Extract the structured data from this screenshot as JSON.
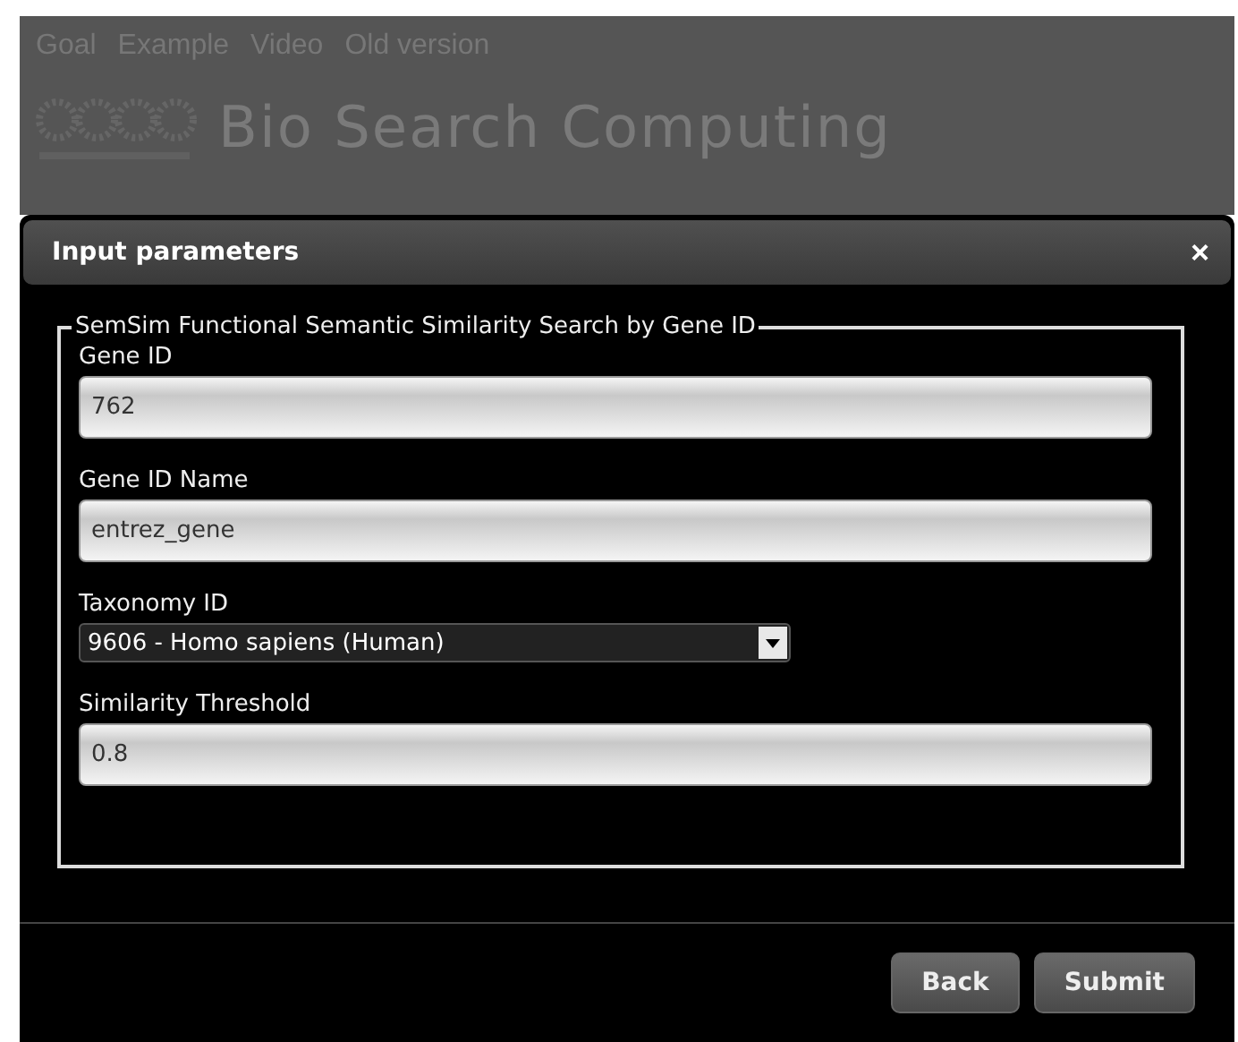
{
  "nav": [
    "Goal",
    "Example",
    "Video",
    "Old version"
  ],
  "site_title": "Bio Search Computing",
  "dialog": {
    "title": "Input parameters",
    "close": "×",
    "fieldset": {
      "legend": "SemSim Functional Semantic Similarity Search by Gene ID",
      "fields": [
        {
          "kind": "text",
          "label": "Gene ID",
          "value": "762"
        },
        {
          "kind": "text",
          "label": "Gene ID Name",
          "value": "entrez_gene"
        },
        {
          "kind": "select",
          "label": "Taxonomy ID",
          "value": "9606 - Homo sapiens (Human)"
        },
        {
          "kind": "text",
          "label": "Similarity Threshold",
          "value": "0.8"
        }
      ]
    },
    "buttons": [
      "Back",
      "Submit"
    ]
  }
}
